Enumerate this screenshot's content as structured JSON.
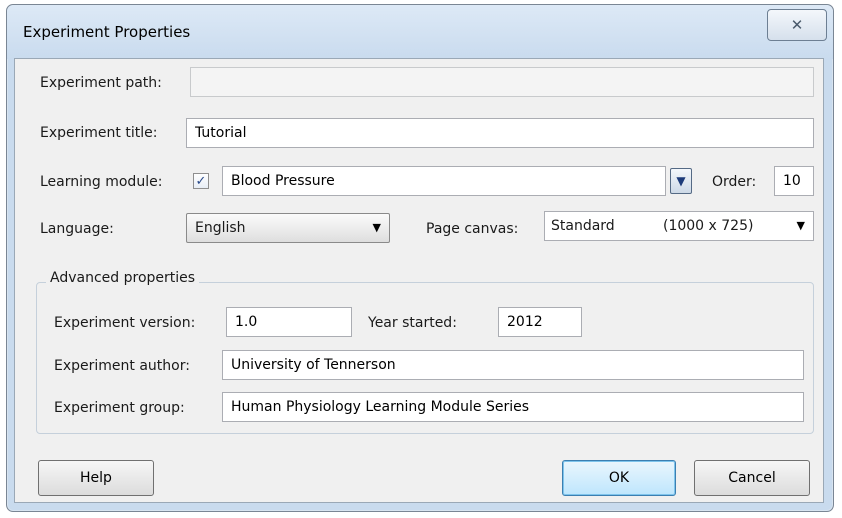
{
  "window": {
    "title": "Experiment Properties",
    "close_glyph": "✕"
  },
  "form": {
    "path_label": "Experiment path:",
    "path_value": "",
    "title_label": "Experiment title:",
    "title_value": "Tutorial",
    "module_label": "Learning module:",
    "module_checked": true,
    "module_value": "Blood Pressure",
    "order_label": "Order:",
    "order_value": "10",
    "language_label": "Language:",
    "language_value": "English",
    "canvas_label": "Page canvas:",
    "canvas_name": "Standard",
    "canvas_size": "(1000 x 725)"
  },
  "advanced": {
    "caption": "Advanced properties",
    "version_label": "Experiment version:",
    "version_value": "1.0",
    "year_label": "Year started:",
    "year_value": "2012",
    "author_label": "Experiment author:",
    "author_value": "University of Tennerson",
    "group_label": "Experiment group:",
    "group_value": "Human Physiology Learning Module Series"
  },
  "buttons": {
    "help": "Help",
    "ok": "OK",
    "cancel": "Cancel"
  },
  "icons": {
    "checkbox": "check-icon",
    "dropdown": "chevron-down-icon",
    "close": "close-icon"
  }
}
